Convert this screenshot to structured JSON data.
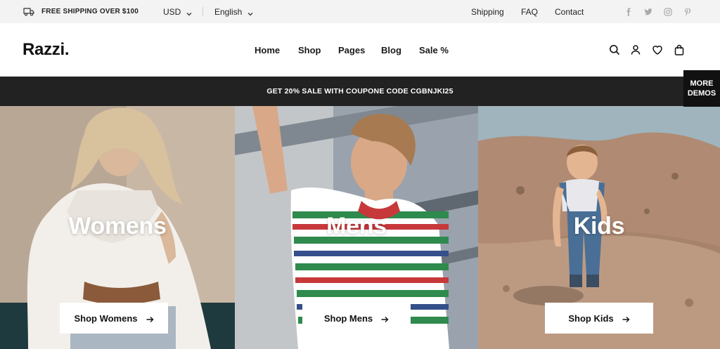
{
  "topbar": {
    "shipping_text": "FREE SHIPPING OVER $100",
    "currency": "USD",
    "language": "English",
    "links": [
      "Shipping",
      "FAQ",
      "Contact"
    ],
    "social_icons": [
      "facebook-icon",
      "twitter-icon",
      "instagram-icon",
      "pinterest-icon"
    ]
  },
  "header": {
    "logo": "Razzi.",
    "nav": [
      "Home",
      "Shop",
      "Pages",
      "Blog",
      "Sale %"
    ],
    "icons": [
      "search-icon",
      "account-icon",
      "wishlist-icon",
      "cart-icon"
    ]
  },
  "promo": {
    "text": "GET 20% SALE WITH COUPONE CODE CGBNJKI25"
  },
  "more_demos": {
    "line1": "MORE",
    "line2": "DEMOS"
  },
  "panels": [
    {
      "title": "Womens",
      "button": "Shop Womens"
    },
    {
      "title": "Mens",
      "button": "Shop Mens"
    },
    {
      "title": "Kids",
      "button": "Shop Kids"
    }
  ],
  "colors": {
    "topbar_bg": "#f3f3f3",
    "promo_bg": "#222222",
    "text_dark": "#111111"
  }
}
